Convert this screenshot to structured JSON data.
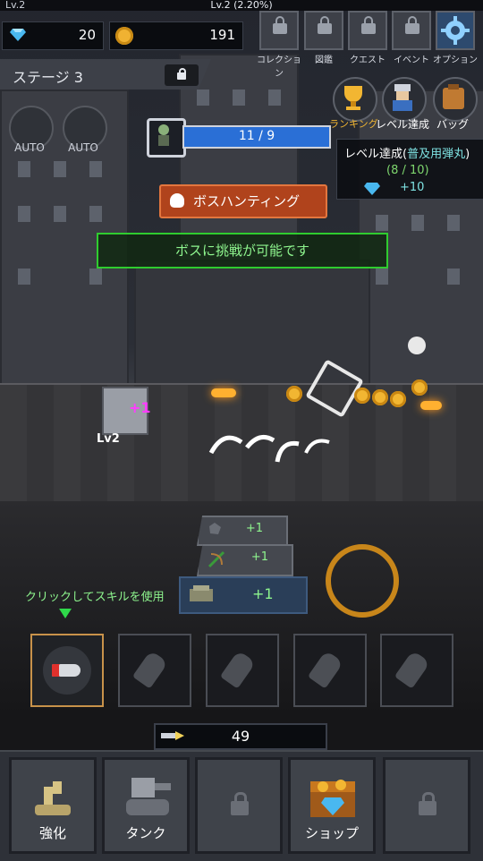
{
  "topbar": {
    "level_left": "Lv.2",
    "level_center": "Lv.2 (2.20%)"
  },
  "currency": {
    "gems": "20",
    "coins": "191"
  },
  "top_buttons": [
    {
      "label": "コレクション",
      "icon": "lock-icon"
    },
    {
      "label": "図鑑",
      "icon": "lock-icon"
    },
    {
      "label": "クエスト",
      "icon": "lock-icon"
    },
    {
      "label": "イベント",
      "icon": "lock-icon"
    },
    {
      "label": "オプション",
      "icon": "gear-icon"
    }
  ],
  "stage": {
    "label": "ステージ 3"
  },
  "auto": {
    "label1": "AUTO",
    "label2": "AUTO"
  },
  "right_buttons": [
    {
      "label": "ランキング",
      "icon": "trophy-icon"
    },
    {
      "label": "レベル達成",
      "icon": "soldier-icon"
    },
    {
      "label": "バッグ",
      "icon": "bag-icon"
    }
  ],
  "boss": {
    "progress_text": "11 / 9",
    "hunt_label": "ボスハンティング",
    "challenge_text": "ボスに挑戦が可能です"
  },
  "mission": {
    "title_prefix": "レベル達成(",
    "title_highlight": "普及用弾丸",
    "title_suffix": ")",
    "progress": "(8 / 10)",
    "reward": "+10"
  },
  "battle": {
    "tank_level": "Lv2",
    "damage_popup": "+1"
  },
  "bonus": [
    {
      "value": "+1"
    },
    {
      "value": "+1"
    }
  ],
  "hint": {
    "text": "クリックしてスキルを使用",
    "suffix": "+1"
  },
  "skills": {
    "active": "bullet-skill-icon",
    "locked": [
      "grenade-icon",
      "grenade-icon",
      "grenade-icon",
      "grenade-icon"
    ]
  },
  "ammo": {
    "count": "49"
  },
  "nav": [
    {
      "label": "強化",
      "icon": "wrench-icon"
    },
    {
      "label": "タンク",
      "icon": "tank-icon"
    },
    {
      "label": "",
      "icon": "lock-icon"
    },
    {
      "label": "ショップ",
      "icon": "treasure-chest-icon"
    },
    {
      "label": "",
      "icon": "lock-icon"
    }
  ],
  "colors": {
    "accent_green": "#2fcc2f",
    "boss_bar": "#2a6fd6",
    "hunt_button": "#b0431c",
    "coin": "#f2b632"
  }
}
